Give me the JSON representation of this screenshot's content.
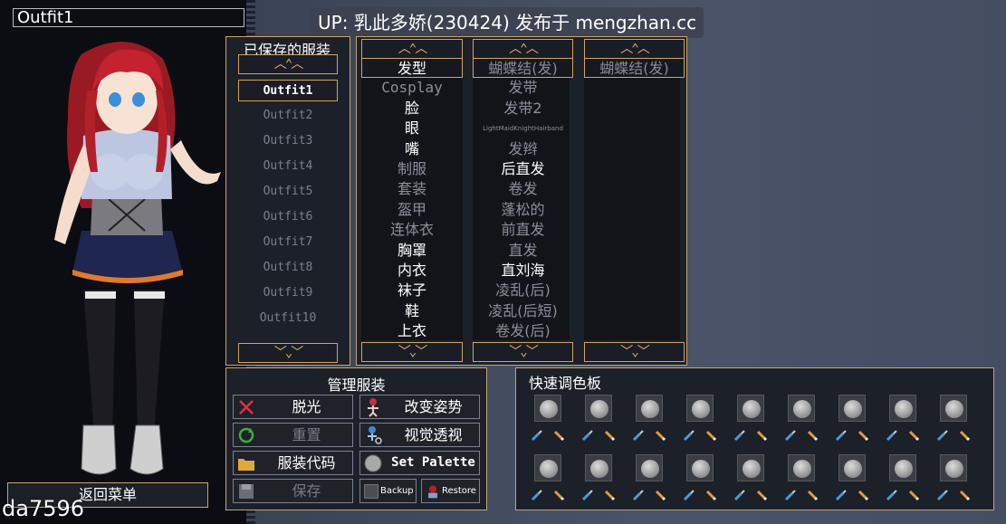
{
  "window": {
    "outfit_name": "Outfit1"
  },
  "banner": {
    "text": "UP: 乳此多娇(230424) 发布于 mengzhan.cc"
  },
  "watermark": {
    "text": "da7596"
  },
  "saved": {
    "title": "已保存的服装",
    "up_arrow": "^",
    "down_arrow": "v",
    "items": [
      "Outfit1",
      "Outfit2",
      "Outfit3",
      "Outfit4",
      "Outfit5",
      "Outfit6",
      "Outfit7",
      "Outfit8",
      "Outfit9",
      "Outfit10"
    ],
    "selected_index": 0
  },
  "categories": {
    "items": [
      "发型",
      "Cosplay",
      "脸",
      "眼",
      "嘴",
      "制服",
      "套装",
      "盔甲",
      "连体衣",
      "胸罩",
      "内衣",
      "袜子",
      "鞋",
      "上衣"
    ],
    "active": [
      "发型",
      "脸",
      "眼",
      "嘴",
      "胸罩",
      "内衣",
      "袜子",
      "鞋",
      "上衣"
    ]
  },
  "options": {
    "items": [
      "蝴蝶结(发)",
      "发带",
      "发带2",
      "LightMaidKnightHairband",
      "发辫",
      "后直发",
      "卷发",
      "蓬松的",
      "前直发",
      "直发",
      "直刘海",
      "凌乱(后)",
      "凌乱(后短)",
      "卷发(后)"
    ],
    "active": [
      "后直发",
      "直刘海"
    ]
  },
  "equipped": {
    "items": [
      "蝴蝶结(发)"
    ]
  },
  "manage": {
    "title": "管理服装",
    "strip": "脱光",
    "change_pose": "改变姿势",
    "reset": "重置",
    "view_through": "视觉透视",
    "outfit_code": "服装代码",
    "set_palette": "Set Palette",
    "save": "保存",
    "backup": "Backup",
    "restore": "Restore"
  },
  "palette": {
    "title": "快速调色板",
    "rows": 2,
    "cols": 9
  },
  "back": {
    "label": "返回菜单"
  },
  "colors": {
    "accent": "#d6a35a",
    "panel": "#1c2029",
    "hair": "#b3202a"
  }
}
